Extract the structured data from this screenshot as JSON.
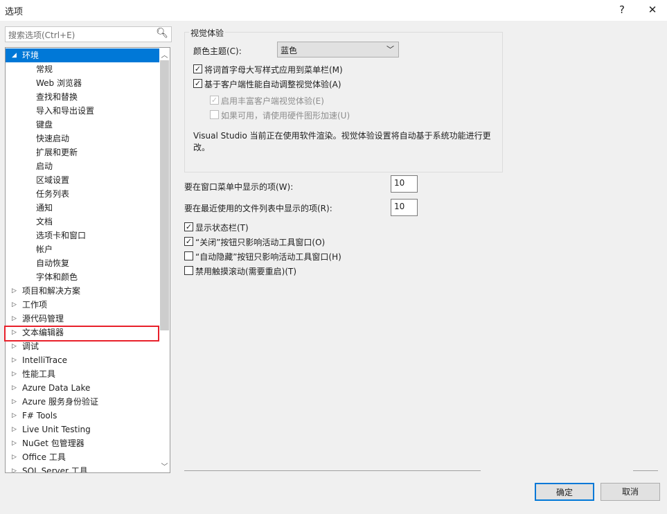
{
  "window": {
    "title": "选项",
    "help": "?",
    "close": "✕"
  },
  "search": {
    "placeholder": "搜索选项(Ctrl+E)",
    "icon": "search-icon"
  },
  "tree": [
    {
      "label": "环境",
      "level": 0,
      "expanded": true,
      "selected": true
    },
    {
      "label": "常规",
      "level": 1
    },
    {
      "label": "Web 浏览器",
      "level": 1
    },
    {
      "label": "查找和替换",
      "level": 1
    },
    {
      "label": "导入和导出设置",
      "level": 1
    },
    {
      "label": "键盘",
      "level": 1
    },
    {
      "label": "快速启动",
      "level": 1
    },
    {
      "label": "扩展和更新",
      "level": 1
    },
    {
      "label": "启动",
      "level": 1
    },
    {
      "label": "区域设置",
      "level": 1
    },
    {
      "label": "任务列表",
      "level": 1
    },
    {
      "label": "通知",
      "level": 1
    },
    {
      "label": "文档",
      "level": 1
    },
    {
      "label": "选项卡和窗口",
      "level": 1
    },
    {
      "label": "帐户",
      "level": 1
    },
    {
      "label": "自动恢复",
      "level": 1
    },
    {
      "label": "字体和颜色",
      "level": 1
    },
    {
      "label": "项目和解决方案",
      "level": 0
    },
    {
      "label": "工作项",
      "level": 0
    },
    {
      "label": "源代码管理",
      "level": 0
    },
    {
      "label": "文本编辑器",
      "level": 0,
      "highlighted": true
    },
    {
      "label": "调试",
      "level": 0
    },
    {
      "label": "IntelliTrace",
      "level": 0
    },
    {
      "label": "性能工具",
      "level": 0
    },
    {
      "label": "Azure Data Lake",
      "level": 0
    },
    {
      "label": "Azure 服务身份验证",
      "level": 0
    },
    {
      "label": "F# Tools",
      "level": 0
    },
    {
      "label": "Live Unit Testing",
      "level": 0
    },
    {
      "label": "NuGet 包管理器",
      "level": 0
    },
    {
      "label": "Office 工具",
      "level": 0
    },
    {
      "label": "SQL Server 工具",
      "level": 0
    }
  ],
  "visual": {
    "group_title": "视觉体验",
    "theme_label": "颜色主题(C):",
    "theme_value": "蓝色",
    "cb_caps": {
      "label": "将词首字母大写样式应用到菜单栏(M)",
      "checked": true
    },
    "cb_auto": {
      "label": "基于客户端性能自动调整视觉体验(A)",
      "checked": true
    },
    "cb_rich": {
      "label": "启用丰富客户端视觉体验(E)",
      "checked": true,
      "disabled": true
    },
    "cb_hw": {
      "label": "如果可用，请使用硬件图形加速(U)",
      "checked": false,
      "disabled": true
    },
    "note": "Visual Studio 当前正在使用软件渲染。视觉体验设置将自动基于系统功能进行更改。"
  },
  "window_menu": {
    "label": "要在窗口菜单中显示的项(W):",
    "value": "10"
  },
  "recent_files": {
    "label": "要在最近使用的文件列表中显示的项(R):",
    "value": "10"
  },
  "options": [
    {
      "label": "显示状态栏(T)",
      "checked": true
    },
    {
      "label": "“关闭”按钮只影响活动工具窗口(O)",
      "checked": true
    },
    {
      "label": "“自动隐藏”按钮只影响活动工具窗口(H)",
      "checked": false
    },
    {
      "label": "禁用触摸滚动(需要重启)(T)",
      "checked": false
    }
  ],
  "buttons": {
    "ok": "确定",
    "cancel": "取消"
  },
  "colors": {
    "accent": "#0078d7",
    "highlight": "#e8202a"
  }
}
